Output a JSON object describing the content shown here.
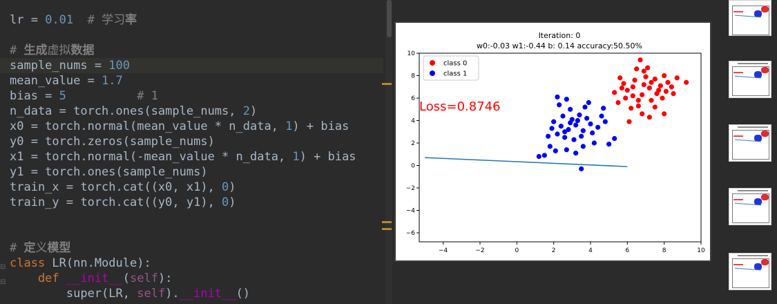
{
  "editor": {
    "lines": [
      {
        "id": "lr",
        "highlight": false,
        "tokens": [
          {
            "t": "lr = "
          },
          {
            "t": "0.01",
            "c": "num"
          },
          {
            "t": "  # 学习",
            "c": "com"
          },
          {
            "t": "率",
            "c": "comb"
          }
        ]
      },
      {
        "id": "blank-1",
        "highlight": false,
        "tokens": []
      },
      {
        "id": "comment-data",
        "highlight": false,
        "tokens": [
          {
            "t": "# ",
            "c": "com"
          },
          {
            "t": "生成",
            "c": "comb"
          },
          {
            "t": "虚拟",
            "c": "com"
          },
          {
            "t": "数据",
            "c": "comb"
          }
        ]
      },
      {
        "id": "sample-nums",
        "highlight": true,
        "tokens": [
          {
            "t": "sample_nums = "
          },
          {
            "t": "100",
            "c": "num"
          }
        ]
      },
      {
        "id": "mean-value",
        "highlight": false,
        "tokens": [
          {
            "t": "mean_value = "
          },
          {
            "t": "1.7",
            "c": "num"
          }
        ]
      },
      {
        "id": "bias",
        "highlight": false,
        "tokens": [
          {
            "t": "bias = "
          },
          {
            "t": "5",
            "c": "num"
          },
          {
            "t": "          # 1",
            "c": "com"
          }
        ]
      },
      {
        "id": "n-data",
        "highlight": false,
        "tokens": [
          {
            "t": "n_data = torch.ones(sample_nums, "
          },
          {
            "t": "2",
            "c": "num"
          },
          {
            "t": ")"
          }
        ]
      },
      {
        "id": "x0",
        "highlight": false,
        "tokens": [
          {
            "t": "x0 = torch.normal(mean_value * n_data, "
          },
          {
            "t": "1",
            "c": "num"
          },
          {
            "t": ") + bias"
          }
        ]
      },
      {
        "id": "y0",
        "highlight": false,
        "tokens": [
          {
            "t": "y0 = torch.zeros(sample_nums)"
          }
        ]
      },
      {
        "id": "x1",
        "highlight": false,
        "tokens": [
          {
            "t": "x1 = torch.normal(-mean_value * n_data, "
          },
          {
            "t": "1",
            "c": "num"
          },
          {
            "t": ") + bias"
          }
        ]
      },
      {
        "id": "y1",
        "highlight": false,
        "tokens": [
          {
            "t": "y1 = torch.ones(sample_nums)"
          }
        ]
      },
      {
        "id": "train-x",
        "highlight": false,
        "tokens": [
          {
            "t": "train_x = torch.cat((x0, x1), "
          },
          {
            "t": "0",
            "c": "num"
          },
          {
            "t": ")"
          }
        ]
      },
      {
        "id": "train-y",
        "highlight": false,
        "tokens": [
          {
            "t": "train_y = torch.cat((y0, y1), "
          },
          {
            "t": "0",
            "c": "num"
          },
          {
            "t": ")"
          }
        ]
      },
      {
        "id": "blank-2",
        "highlight": false,
        "tokens": []
      },
      {
        "id": "blank-3",
        "highlight": false,
        "tokens": []
      },
      {
        "id": "comment-model",
        "highlight": false,
        "tokens": [
          {
            "t": "# ",
            "c": "com"
          },
          {
            "t": "定",
            "c": "comb"
          },
          {
            "t": "义",
            "c": "com"
          },
          {
            "t": "模型",
            "c": "comb"
          }
        ]
      },
      {
        "id": "class-lr",
        "highlight": false,
        "tokens": [
          {
            "t": "class ",
            "c": "kw"
          },
          {
            "t": "LR(nn.Module):"
          }
        ]
      },
      {
        "id": "def-init",
        "highlight": false,
        "tokens": [
          {
            "t": "    def ",
            "c": "kw"
          },
          {
            "t": "__init__",
            "c": "magic"
          },
          {
            "t": "("
          },
          {
            "t": "self",
            "c": "self"
          },
          {
            "t": "):"
          }
        ]
      },
      {
        "id": "super-init",
        "highlight": false,
        "tokens": [
          {
            "t": "        super(LR, "
          },
          {
            "t": "self",
            "c": "self"
          },
          {
            "t": ")."
          },
          {
            "t": "__init__",
            "c": "magic"
          },
          {
            "t": "()"
          }
        ]
      }
    ]
  },
  "chart_data": {
    "type": "scatter",
    "title": "Iteration: 0",
    "subtitle": "w0:-0.03 w1:-0.44 b: 0.14 accuracy:50.50%",
    "annotation": "Loss=0.8746",
    "xlim": [
      -5.3,
      10
    ],
    "ylim": [
      -6.8,
      10
    ],
    "xticks": [
      -4,
      -2,
      0,
      2,
      4,
      6,
      8,
      10
    ],
    "yticks": [
      -6,
      -4,
      -2,
      0,
      2,
      4,
      6,
      8,
      10
    ],
    "xtick_labels": [
      "−4",
      "−2",
      "0",
      "2",
      "4",
      "6",
      "8",
      "10"
    ],
    "ytick_labels": [
      "−6",
      "−4",
      "−2",
      "0",
      "2",
      "4",
      "6",
      "8",
      "10"
    ],
    "grid": false,
    "legend_position": "top-left",
    "series": [
      {
        "name": "class 0",
        "color": "#ff0000",
        "points": [
          [
            6.2,
            5.1
          ],
          [
            6.6,
            5.3
          ],
          [
            5.9,
            6.0
          ],
          [
            6.3,
            6.2
          ],
          [
            6.0,
            6.7
          ],
          [
            5.8,
            7.3
          ],
          [
            6.4,
            7.6
          ],
          [
            6.9,
            8.4
          ],
          [
            7.0,
            7.9
          ],
          [
            7.5,
            7.7
          ],
          [
            7.8,
            7.1
          ],
          [
            8.1,
            6.6
          ],
          [
            8.2,
            7.4
          ],
          [
            7.2,
            6.9
          ],
          [
            6.8,
            6.3
          ],
          [
            7.3,
            5.8
          ],
          [
            7.9,
            6.0
          ],
          [
            8.4,
            7.0
          ],
          [
            9.2,
            7.4
          ],
          [
            6.7,
            9.4
          ],
          [
            6.5,
            8.6
          ],
          [
            5.6,
            7.8
          ],
          [
            5.3,
            6.5
          ],
          [
            5.5,
            5.6
          ],
          [
            6.8,
            4.6
          ],
          [
            7.5,
            5.2
          ],
          [
            8.0,
            4.6
          ],
          [
            7.2,
            4.3
          ],
          [
            6.1,
            3.9
          ],
          [
            7.1,
            8.7
          ],
          [
            8.7,
            7.8
          ],
          [
            8.0,
            8.0
          ],
          [
            6.3,
            7.0
          ],
          [
            7.6,
            6.4
          ],
          [
            6.9,
            7.2
          ],
          [
            7.3,
            7.4
          ],
          [
            7.7,
            6.7
          ],
          [
            8.5,
            6.4
          ],
          [
            5.7,
            6.9
          ],
          [
            6.6,
            5.8
          ]
        ]
      },
      {
        "name": "class 1",
        "color": "#0000ff",
        "points": [
          [
            2.0,
            3.9
          ],
          [
            2.4,
            3.5
          ],
          [
            2.8,
            3.2
          ],
          [
            3.2,
            3.6
          ],
          [
            3.6,
            3.1
          ],
          [
            4.0,
            3.7
          ],
          [
            2.5,
            4.4
          ],
          [
            3.0,
            4.1
          ],
          [
            3.4,
            4.5
          ],
          [
            3.8,
            4.2
          ],
          [
            2.2,
            2.8
          ],
          [
            2.6,
            2.5
          ],
          [
            3.1,
            2.3
          ],
          [
            3.5,
            2.6
          ],
          [
            4.1,
            2.9
          ],
          [
            4.4,
            3.4
          ],
          [
            1.9,
            3.3
          ],
          [
            1.7,
            2.6
          ],
          [
            2.9,
            5.0
          ],
          [
            2.3,
            5.4
          ],
          [
            3.7,
            5.2
          ],
          [
            4.6,
            4.4
          ],
          [
            4.8,
            3.9
          ],
          [
            5.3,
            2.4
          ],
          [
            5.0,
            1.9
          ],
          [
            4.2,
            2.0
          ],
          [
            3.6,
            1.7
          ],
          [
            2.7,
            1.4
          ],
          [
            2.1,
            1.3
          ],
          [
            1.8,
            1.7
          ],
          [
            1.5,
            0.9
          ],
          [
            1.2,
            0.8
          ],
          [
            2.2,
            6.1
          ],
          [
            2.7,
            5.9
          ],
          [
            3.9,
            5.6
          ],
          [
            4.7,
            5.1
          ],
          [
            3.2,
            1.1
          ],
          [
            3.5,
            -0.3
          ],
          [
            2.9,
            3.8
          ],
          [
            3.3,
            4.0
          ],
          [
            2.6,
            3.0
          ]
        ]
      }
    ],
    "line": {
      "color": "#1f77b4",
      "points": [
        [
          -5.0,
          0.7
        ],
        [
          6.0,
          -0.1
        ]
      ]
    }
  }
}
